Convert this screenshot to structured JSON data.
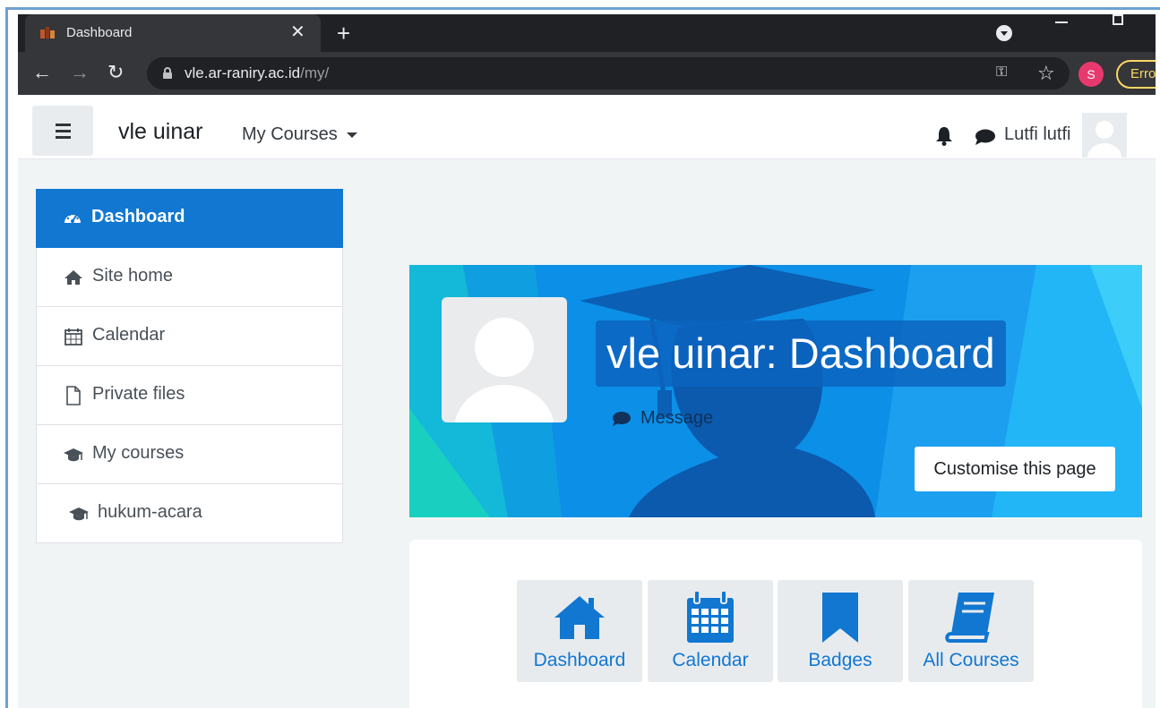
{
  "browser": {
    "tab_title": "Dashboard",
    "tab_close": "✕",
    "new_tab": "+",
    "url_host": "vle.ar-raniry.ac.id",
    "url_path": "/my/",
    "profile_initial": "S",
    "error_chip": "Error"
  },
  "navbar": {
    "site_name": "vle uinar",
    "my_courses": "My Courses",
    "user_name": "Lutfi lutfi"
  },
  "sidebar": {
    "items": [
      {
        "label": "Dashboard",
        "icon": "dashboard-icon",
        "active": true
      },
      {
        "label": "Site home",
        "icon": "home-icon"
      },
      {
        "label": "Calendar",
        "icon": "calendar-icon"
      },
      {
        "label": "Private files",
        "icon": "file-icon"
      },
      {
        "label": "My courses",
        "icon": "graduation-cap-icon"
      },
      {
        "label": "hukum-acara",
        "icon": "graduation-cap-icon"
      }
    ]
  },
  "header": {
    "title": "vle uinar: Dashboard",
    "message": "Message",
    "customise_button": "Customise this page"
  },
  "quick_links": [
    {
      "label": "Dashboard",
      "icon": "home-icon"
    },
    {
      "label": "Calendar",
      "icon": "calendar-icon"
    },
    {
      "label": "Badges",
      "icon": "bookmark-icon"
    },
    {
      "label": "All Courses",
      "icon": "book-icon"
    }
  ],
  "colors": {
    "brand_blue": "#1177d1",
    "browser_dark": "#202124",
    "browser_toolbar": "#35363a",
    "page_bg": "#f1f4f5"
  }
}
